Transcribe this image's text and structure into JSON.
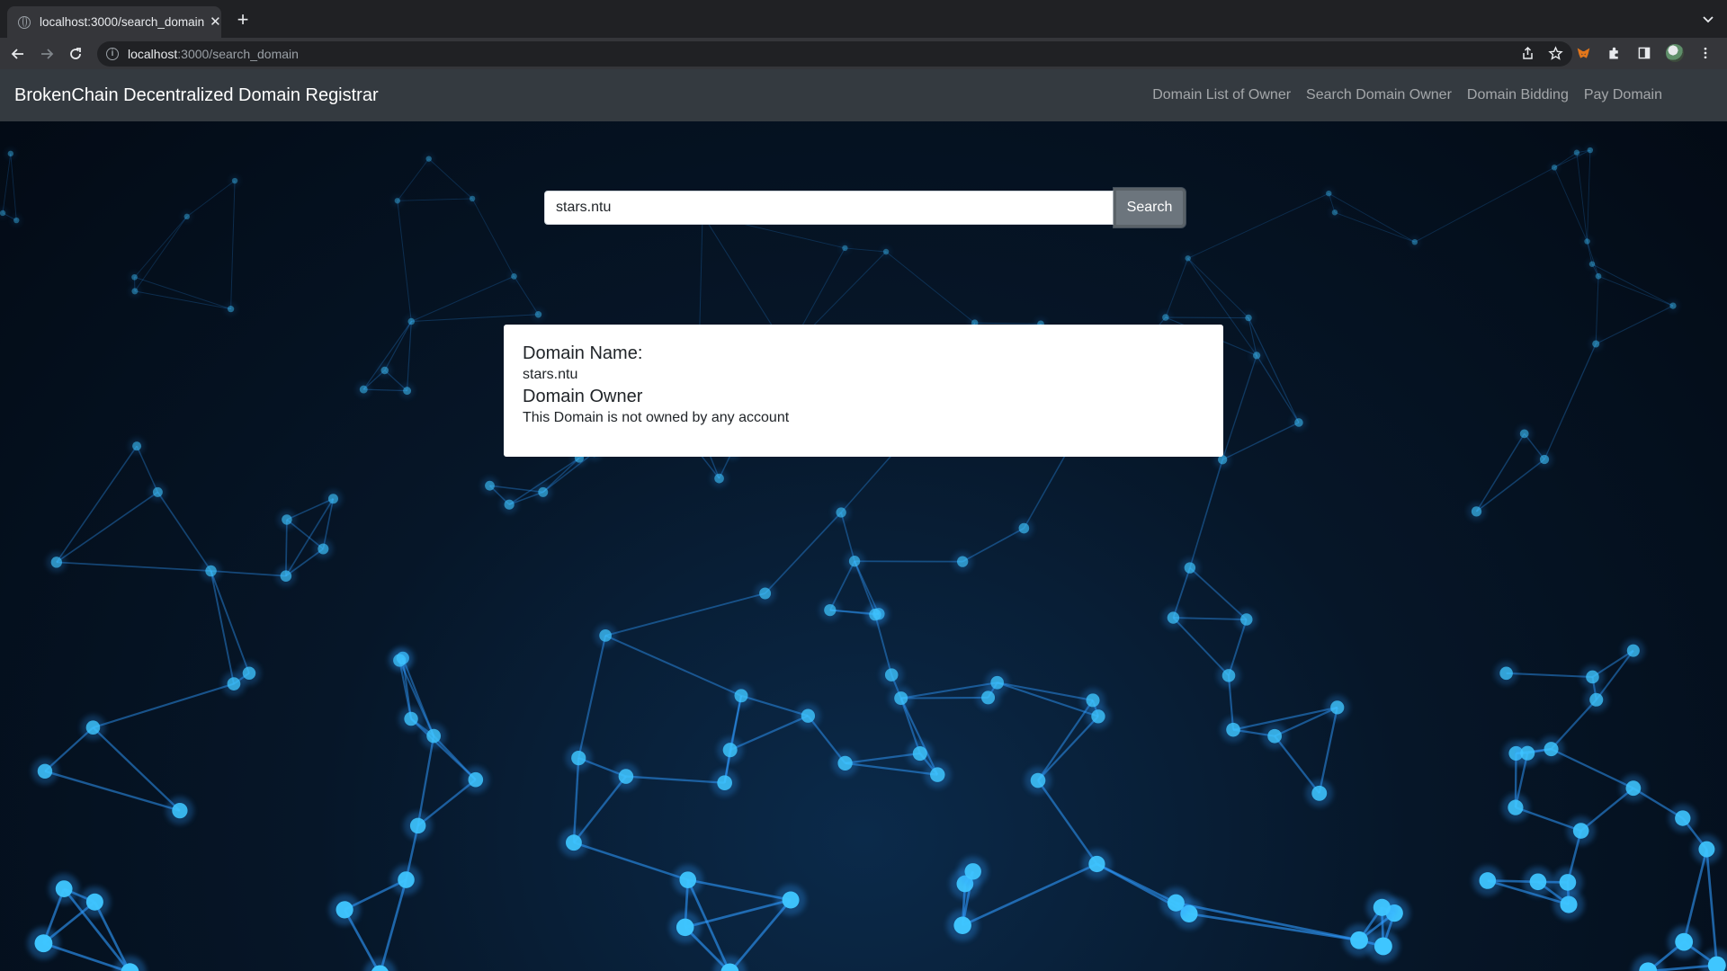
{
  "browser": {
    "tab_title": "localhost:3000/search_domain",
    "url_host": "localhost",
    "url_rest": ":3000/search_domain"
  },
  "navbar": {
    "brand": "BrokenChain Decentralized Domain Registrar",
    "links": [
      {
        "label": "Domain List of Owner"
      },
      {
        "label": "Search Domain Owner"
      },
      {
        "label": "Domain Bidding"
      },
      {
        "label": "Pay Domain"
      }
    ]
  },
  "search": {
    "value": "stars.ntu",
    "button_label": "Search"
  },
  "result": {
    "name_heading": "Domain Name:",
    "name_value": "stars.ntu",
    "owner_heading": "Domain Owner",
    "owner_value": "This Domain is not owned by any account"
  },
  "colors": {
    "navbar_bg": "#343a40",
    "button_bg": "#6c757d",
    "network_glow": "#2f9bff"
  }
}
